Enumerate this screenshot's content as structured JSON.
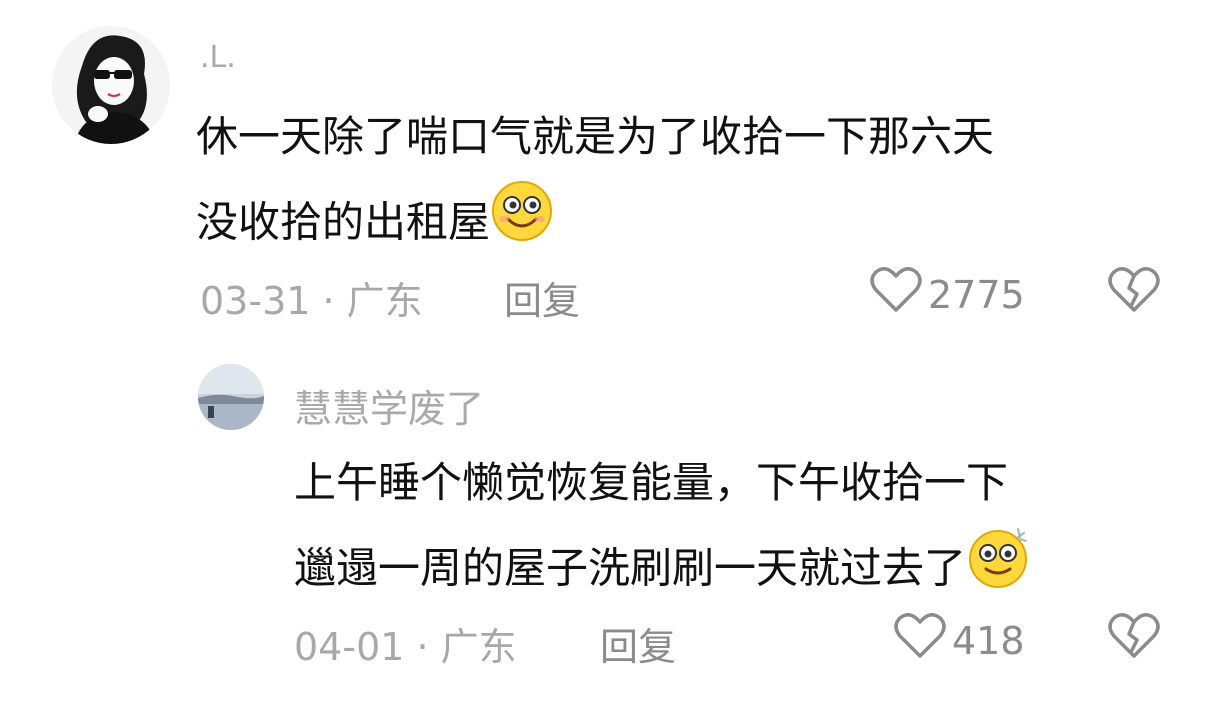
{
  "comments": [
    {
      "username": ".L.",
      "lines": [
        "休一天除了喘口气就是为了收拾一下那六天",
        "没收拾的出租屋"
      ],
      "emoji": "smile-emoji",
      "date_location": "03-31 · 广东",
      "reply_label": "回复",
      "like_count": "2775",
      "icons": {
        "like": "heart-outline-icon",
        "dislike": "broken-heart-icon"
      }
    },
    {
      "username": "慧慧学废了",
      "lines": [
        "上午睡个懒觉恢复能量，下午收拾一下",
        "邋遢一周的屋子洗刷刷一天就过去了"
      ],
      "emoji": "sweat-smile-emoji",
      "date_location": "04-01 · 广东",
      "reply_label": "回复",
      "like_count": "418",
      "icons": {
        "like": "heart-outline-icon",
        "dislike": "broken-heart-icon"
      }
    }
  ],
  "colors": {
    "text": "#111111",
    "muted": "#a8a8a8",
    "secondary": "#8b8b8b",
    "emoji_yellow": "#ffd93b"
  }
}
